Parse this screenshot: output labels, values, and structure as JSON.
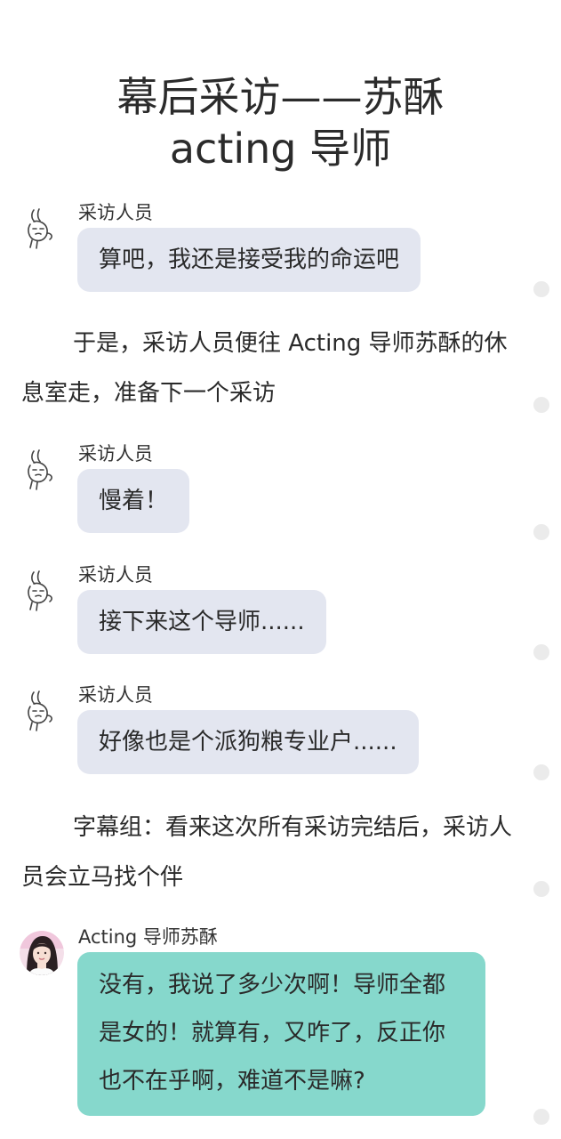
{
  "title": {
    "line1": "幕后采访——苏酥",
    "line2": "acting 导师"
  },
  "messages": [
    {
      "sender": "采访人员",
      "text": "算吧，我还是接受我的命运吧",
      "avatar": "rabbit-sketch-icon"
    },
    {
      "sender": "采访人员",
      "text": "慢着！",
      "avatar": "rabbit-sketch-icon"
    },
    {
      "sender": "采访人员",
      "text": "接下来这个导师......",
      "avatar": "rabbit-sketch-icon"
    },
    {
      "sender": "采访人员",
      "text": "好像也是个派狗粮专业户......",
      "avatar": "rabbit-sketch-icon"
    },
    {
      "sender": "Acting 导师苏酥",
      "text": "没有，我说了多少次啊！导师全都是女的！就算有，又咋了，反正你也不在乎啊，难道不是嘛?",
      "avatar": "girl-portrait-avatar"
    }
  ],
  "narrations": [
    "于是，采访人员便往 Acting 导师苏酥的休息室走，准备下一个采访",
    "字幕组：看来这次所有采访完结后，采访人员会立马找个伴"
  ],
  "colors": {
    "bubble_gray": "#e3e6f0",
    "bubble_teal": "#86d8cc",
    "dot": "#ebebeb"
  }
}
